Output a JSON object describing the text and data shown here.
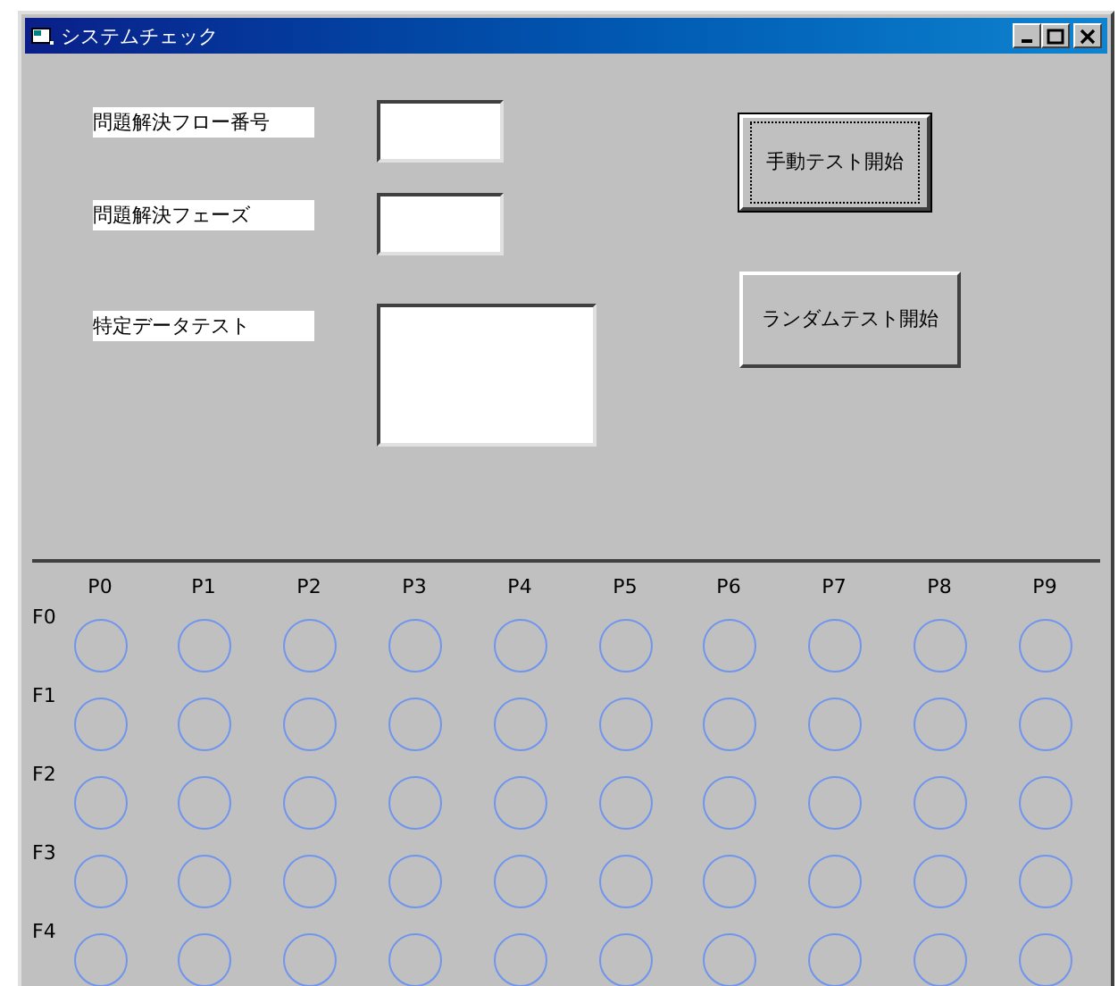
{
  "window": {
    "title": "システムチェック"
  },
  "fields": [
    {
      "label": "問題解決フロー番号",
      "kind": "small"
    },
    {
      "label": "問題解決フェーズ",
      "kind": "small"
    },
    {
      "label": "特定データテスト",
      "kind": "large"
    }
  ],
  "buttons": [
    {
      "label": "手動テスト開始",
      "focused": true
    },
    {
      "label": "ランダムテスト開始",
      "focused": false
    }
  ],
  "grid": {
    "columns": [
      "P0",
      "P1",
      "P2",
      "P3",
      "P4",
      "P5",
      "P6",
      "P7",
      "P8",
      "P9"
    ],
    "rows": [
      "F0",
      "F1",
      "F2",
      "F3",
      "F4"
    ]
  }
}
